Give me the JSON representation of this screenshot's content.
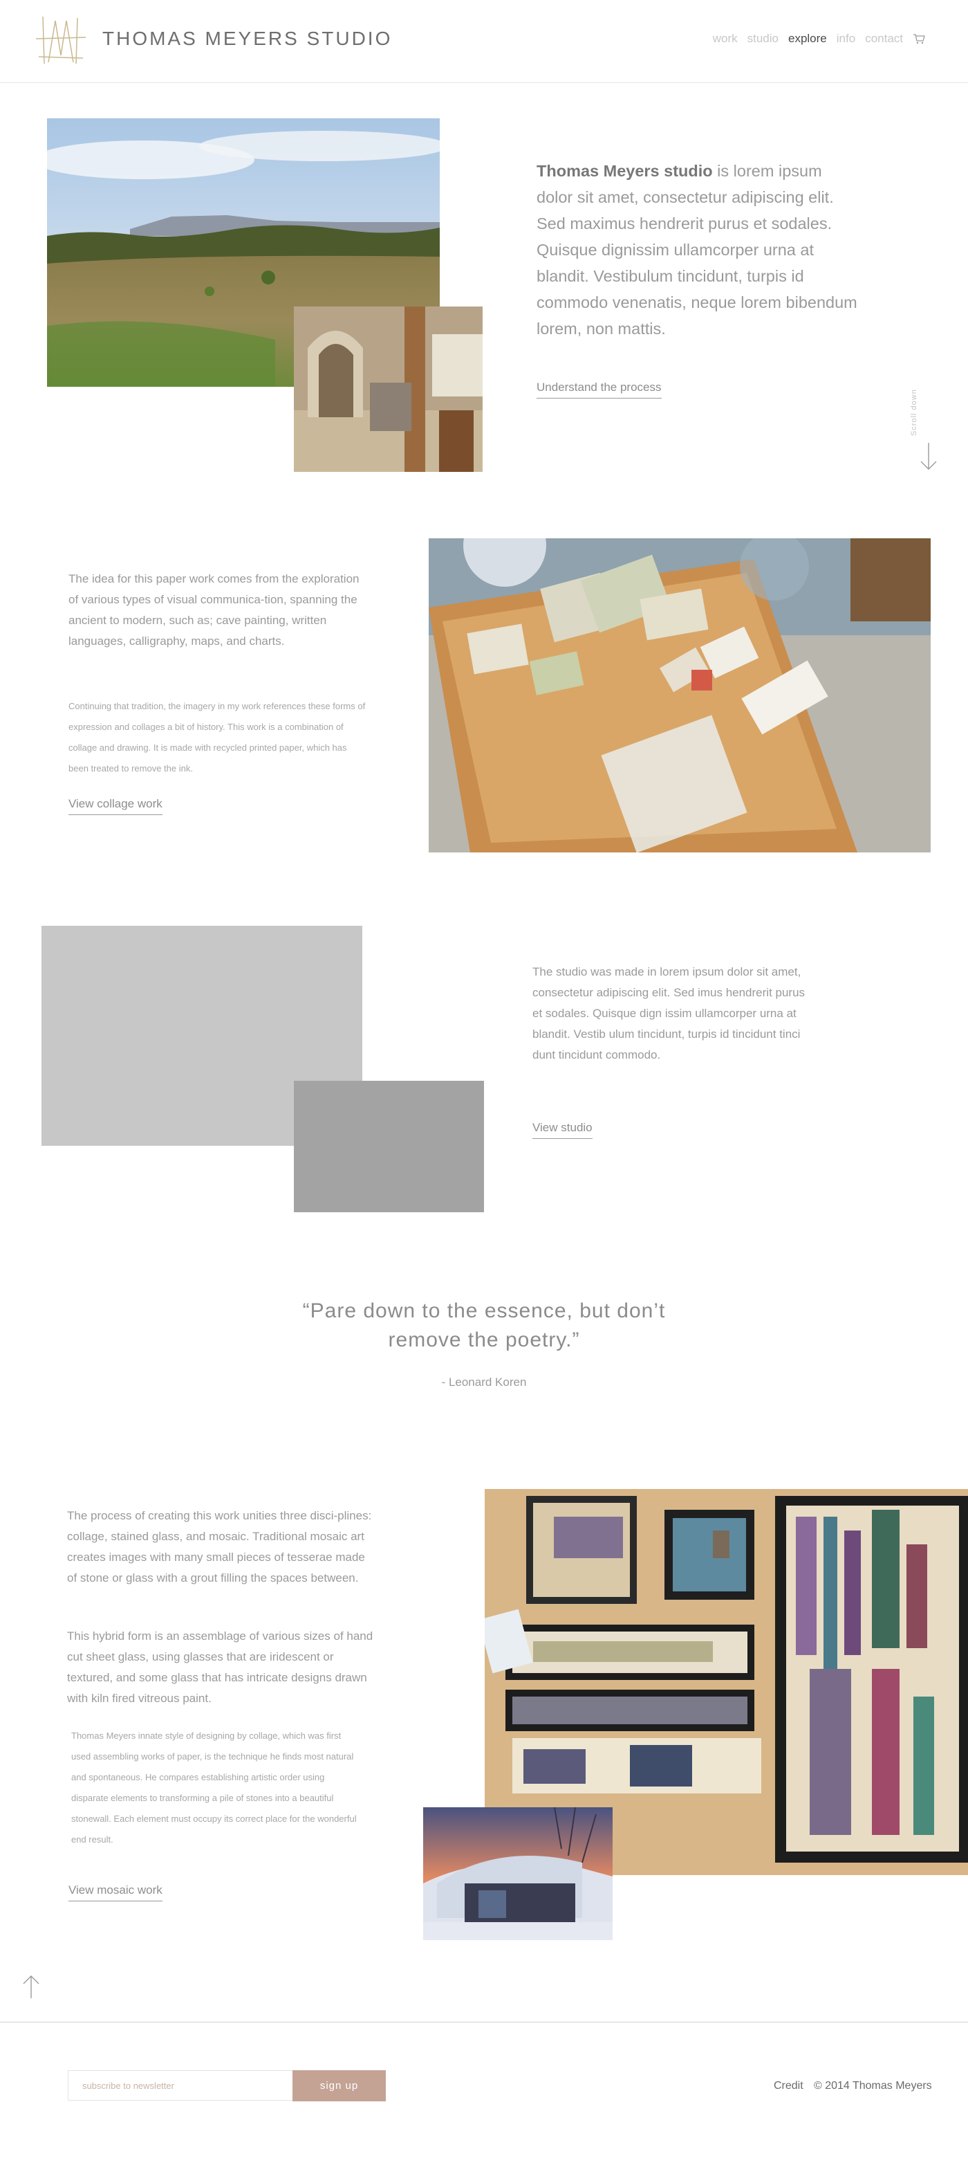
{
  "header": {
    "brand": "THOMAS MEYERS STUDIO",
    "nav": [
      {
        "label": "work",
        "active": false
      },
      {
        "label": "studio",
        "active": false
      },
      {
        "label": "explore",
        "active": true
      },
      {
        "label": "info",
        "active": false
      },
      {
        "label": "contact",
        "active": false
      }
    ],
    "cart_icon": "cart-icon"
  },
  "intro": {
    "brand_strong": "Thomas Meyers studio",
    "text": " is lorem ipsum dolor sit amet, consectetur adipiscing elit. Sed maximus hendrerit purus et sodales. Quisque dignissim ullamcorper urna at blandit. Vestibulum tincidunt, turpis id commodo venenatis, neque lorem bibendum lorem, non mattis.",
    "link": "Understand the process",
    "scroll_label": "Scroll down"
  },
  "collage": {
    "p1": "The idea for this paper work comes from the exploration of various types of visual communica-tion, spanning the ancient to modern, such as; cave painting, written languages, calligraphy, maps, and charts.",
    "p2": "Continuing that tradition, the imagery in my work references these forms of expression and collages a bit of history. This work is a combination of collage and drawing. It is made with recycled printed paper, which has been treated to remove the ink.",
    "link": "View collage work"
  },
  "studio": {
    "text": "The studio was made in lorem ipsum dolor sit amet, consectetur adipiscing elit. Sed imus hendrerit purus et sodales. Quisque dign issim ullamcorper urna at blandit. Vestib ulum tincidunt, turpis id tincidunt tinci dunt tincidunt commodo.",
    "link": "View studio"
  },
  "quote": {
    "text": "“Pare down to the essence, but don’t remove the poetry.”",
    "author": "- Leonard Koren"
  },
  "mosaic": {
    "p1": "The process of creating this work unities three disci-plines: collage, stained glass, and mosaic. Traditional mosaic art creates images with many small pieces of tesserae made of stone or glass with a grout filling the spaces between.",
    "p2": "This hybrid form is an assemblage of various sizes of hand cut sheet glass, using glasses that are iridescent or textured, and some glass that has intricate designs drawn with kiln fired vitreous paint.",
    "p3": "Thomas Meyers innate style of designing by collage, which was first used assembling works of paper, is the technique he finds most natural and spontaneous. He compares establishing artistic order using disparate elements to transforming a pile of stones into a beautiful stonewall. Each element must occupy its correct place for the wonderful end result.",
    "link": "View mosaic work"
  },
  "footer": {
    "newsletter_placeholder": "subscribe to newsletter",
    "signup": "sign up",
    "credit": "Credit",
    "copyright": "© 2014 Thomas Meyers"
  },
  "colors": {
    "accent": "#c4a395",
    "logo": "#c9b88f",
    "text": "#8a8a8a"
  }
}
